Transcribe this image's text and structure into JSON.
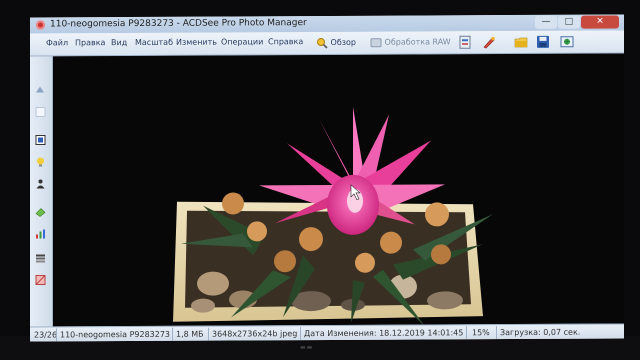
{
  "window": {
    "title": "110-neogomesia P9283273 - ACDSee Pro Photo Manager",
    "minimize": "—",
    "maximize": "□",
    "close": "✕"
  },
  "menu": {
    "items": [
      "Файл",
      "Правка",
      "Вид",
      "Масштаб",
      "Изменить",
      "Операции",
      "Справка"
    ],
    "browse_button": "Обзор",
    "raw_button": "Обработка RAW"
  },
  "icons": {
    "toolbar": [
      "browse-icon",
      "raw-icon",
      "print-icon",
      "edit-icon",
      "folder-icon",
      "save-icon",
      "web-icon"
    ],
    "left": [
      "arrow-icon",
      "blank-icon",
      "crop-icon",
      "lightbulb-icon",
      "person-icon",
      "eraser-icon",
      "chart-icon",
      "layers-icon",
      "adjust-icon"
    ]
  },
  "image": {
    "subject": "pink flowering cactus in a wooden box"
  },
  "status": {
    "position": "23/26",
    "filename": "110-neogomesia P9283273",
    "filesize": "1,8 МБ",
    "dimensions": "3648x2736x24b jpeg",
    "modified": "Дата Изменения: 18.12.2019 14:01:45",
    "zoom": "15%",
    "load_time": "Загрузка: 0,07 сек."
  },
  "colors": {
    "accent": "#2a3d63",
    "flower": "#e8409a",
    "close_button": "#c8493d",
    "viewer_background": "#090909"
  }
}
